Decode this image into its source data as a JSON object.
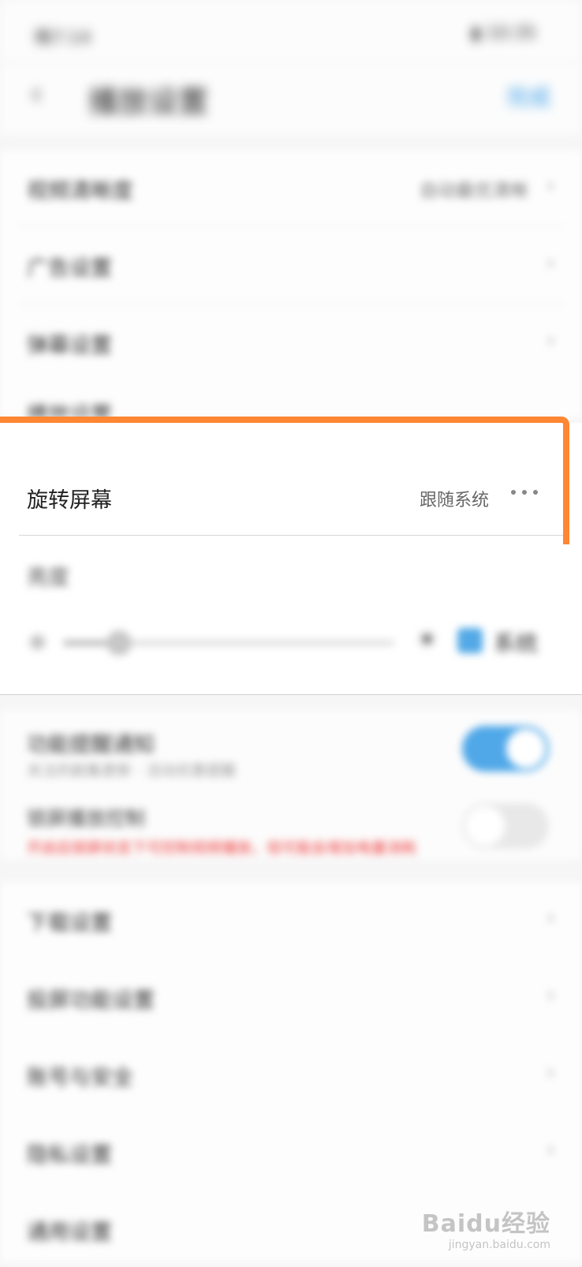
{
  "status_bar": {
    "time": "晚7:14",
    "battery": "▮ 10:35"
  },
  "header": {
    "title": "播放设置",
    "action": "完成"
  },
  "rows_top": [
    {
      "label": "视频清晰度",
      "value": "自动最优清晰"
    },
    {
      "label": "广告设置",
      "value": ""
    },
    {
      "label": "弹幕设置",
      "value": ""
    },
    {
      "label": "播放设置",
      "value": ""
    }
  ],
  "rotate": {
    "label": "旋转屏幕",
    "value": "跟随系统"
  },
  "brightness": {
    "label": "亮度",
    "system_label": "系统",
    "level": 0.17
  },
  "notices": {
    "title": "功能提醒通知",
    "subtitle": "关注的剧集更新 · 活动优惠提醒",
    "title2": "锁屏播放控制",
    "subtitle2": "开启后锁屏状态下可控制视频播放，但可能会增加电量消耗"
  },
  "rows_bottom": [
    {
      "label": "下载设置"
    },
    {
      "label": "投屏功能设置"
    },
    {
      "label": "账号与安全"
    },
    {
      "label": "隐私设置"
    },
    {
      "label": "通用设置"
    }
  ],
  "watermark": {
    "logo": "Baidu经验",
    "url": "jingyan.baidu.com"
  },
  "colors": {
    "highlight": "#ff8633",
    "accent": "#50a8e8",
    "warning": "#ee3b3b"
  }
}
